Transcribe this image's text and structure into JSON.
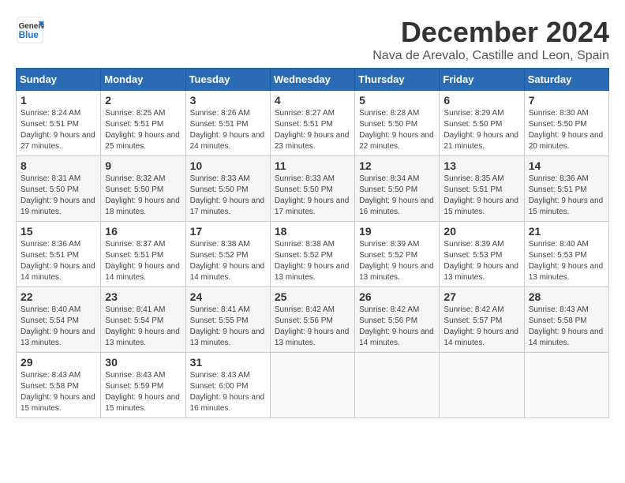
{
  "logo": {
    "line1": "General",
    "line2": "Blue"
  },
  "title": "December 2024",
  "subtitle": "Nava de Arevalo, Castille and Leon, Spain",
  "weekdays": [
    "Sunday",
    "Monday",
    "Tuesday",
    "Wednesday",
    "Thursday",
    "Friday",
    "Saturday"
  ],
  "weeks": [
    [
      {
        "day": "1",
        "sunrise": "8:24 AM",
        "sunset": "5:51 PM",
        "daylight": "9 hours and 27 minutes."
      },
      {
        "day": "2",
        "sunrise": "8:25 AM",
        "sunset": "5:51 PM",
        "daylight": "9 hours and 25 minutes."
      },
      {
        "day": "3",
        "sunrise": "8:26 AM",
        "sunset": "5:51 PM",
        "daylight": "9 hours and 24 minutes."
      },
      {
        "day": "4",
        "sunrise": "8:27 AM",
        "sunset": "5:51 PM",
        "daylight": "9 hours and 23 minutes."
      },
      {
        "day": "5",
        "sunrise": "8:28 AM",
        "sunset": "5:50 PM",
        "daylight": "9 hours and 22 minutes."
      },
      {
        "day": "6",
        "sunrise": "8:29 AM",
        "sunset": "5:50 PM",
        "daylight": "9 hours and 21 minutes."
      },
      {
        "day": "7",
        "sunrise": "8:30 AM",
        "sunset": "5:50 PM",
        "daylight": "9 hours and 20 minutes."
      }
    ],
    [
      {
        "day": "8",
        "sunrise": "8:31 AM",
        "sunset": "5:50 PM",
        "daylight": "9 hours and 19 minutes."
      },
      {
        "day": "9",
        "sunrise": "8:32 AM",
        "sunset": "5:50 PM",
        "daylight": "9 hours and 18 minutes."
      },
      {
        "day": "10",
        "sunrise": "8:33 AM",
        "sunset": "5:50 PM",
        "daylight": "9 hours and 17 minutes."
      },
      {
        "day": "11",
        "sunrise": "8:33 AM",
        "sunset": "5:50 PM",
        "daylight": "9 hours and 17 minutes."
      },
      {
        "day": "12",
        "sunrise": "8:34 AM",
        "sunset": "5:50 PM",
        "daylight": "9 hours and 16 minutes."
      },
      {
        "day": "13",
        "sunrise": "8:35 AM",
        "sunset": "5:51 PM",
        "daylight": "9 hours and 15 minutes."
      },
      {
        "day": "14",
        "sunrise": "8:36 AM",
        "sunset": "5:51 PM",
        "daylight": "9 hours and 15 minutes."
      }
    ],
    [
      {
        "day": "15",
        "sunrise": "8:36 AM",
        "sunset": "5:51 PM",
        "daylight": "9 hours and 14 minutes."
      },
      {
        "day": "16",
        "sunrise": "8:37 AM",
        "sunset": "5:51 PM",
        "daylight": "9 hours and 14 minutes."
      },
      {
        "day": "17",
        "sunrise": "8:38 AM",
        "sunset": "5:52 PM",
        "daylight": "9 hours and 14 minutes."
      },
      {
        "day": "18",
        "sunrise": "8:38 AM",
        "sunset": "5:52 PM",
        "daylight": "9 hours and 13 minutes."
      },
      {
        "day": "19",
        "sunrise": "8:39 AM",
        "sunset": "5:52 PM",
        "daylight": "9 hours and 13 minutes."
      },
      {
        "day": "20",
        "sunrise": "8:39 AM",
        "sunset": "5:53 PM",
        "daylight": "9 hours and 13 minutes."
      },
      {
        "day": "21",
        "sunrise": "8:40 AM",
        "sunset": "5:53 PM",
        "daylight": "9 hours and 13 minutes."
      }
    ],
    [
      {
        "day": "22",
        "sunrise": "8:40 AM",
        "sunset": "5:54 PM",
        "daylight": "9 hours and 13 minutes."
      },
      {
        "day": "23",
        "sunrise": "8:41 AM",
        "sunset": "5:54 PM",
        "daylight": "9 hours and 13 minutes."
      },
      {
        "day": "24",
        "sunrise": "8:41 AM",
        "sunset": "5:55 PM",
        "daylight": "9 hours and 13 minutes."
      },
      {
        "day": "25",
        "sunrise": "8:42 AM",
        "sunset": "5:56 PM",
        "daylight": "9 hours and 13 minutes."
      },
      {
        "day": "26",
        "sunrise": "8:42 AM",
        "sunset": "5:56 PM",
        "daylight": "9 hours and 14 minutes."
      },
      {
        "day": "27",
        "sunrise": "8:42 AM",
        "sunset": "5:57 PM",
        "daylight": "9 hours and 14 minutes."
      },
      {
        "day": "28",
        "sunrise": "8:43 AM",
        "sunset": "5:58 PM",
        "daylight": "9 hours and 14 minutes."
      }
    ],
    [
      {
        "day": "29",
        "sunrise": "8:43 AM",
        "sunset": "5:58 PM",
        "daylight": "9 hours and 15 minutes."
      },
      {
        "day": "30",
        "sunrise": "8:43 AM",
        "sunset": "5:59 PM",
        "daylight": "9 hours and 15 minutes."
      },
      {
        "day": "31",
        "sunrise": "8:43 AM",
        "sunset": "6:00 PM",
        "daylight": "9 hours and 16 minutes."
      },
      null,
      null,
      null,
      null
    ]
  ]
}
